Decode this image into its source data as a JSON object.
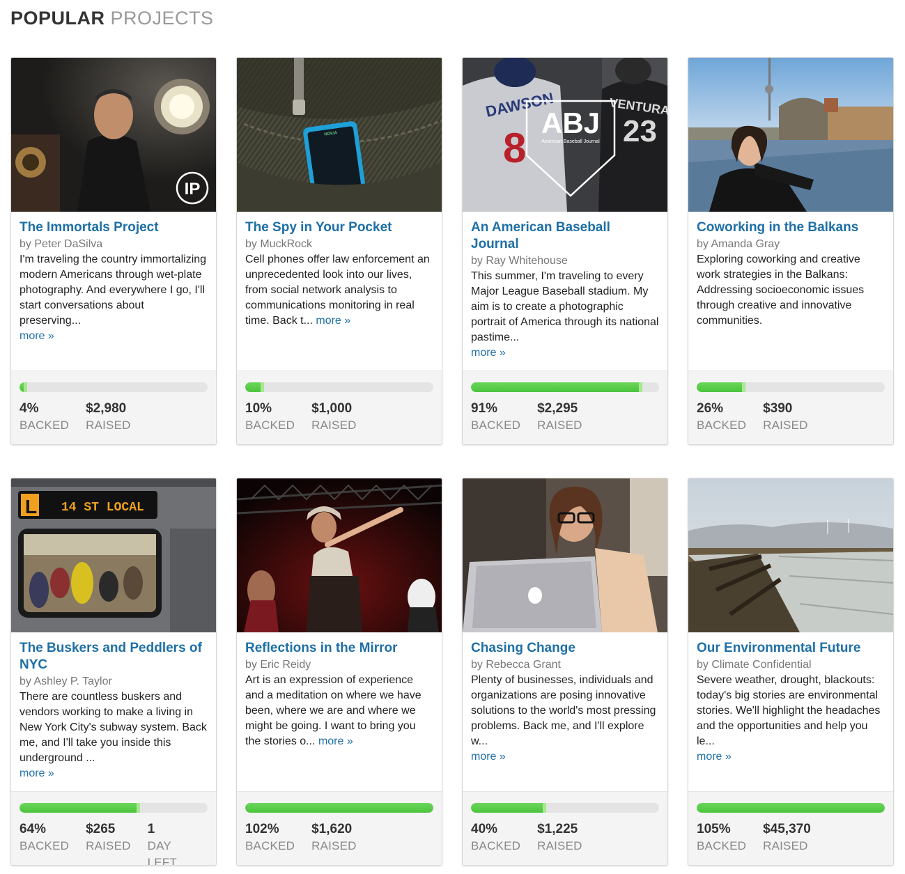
{
  "header": {
    "title_bold": "POPULAR",
    "title_light": "PROJECTS"
  },
  "colors": {
    "link": "#1e6fa6",
    "progress": "#4cc43e",
    "footer_bg": "#f4f4f4"
  },
  "projects": [
    {
      "title": "The Immortals Project",
      "author": "by Peter DaSilva",
      "description": "I'm traveling the country immortalizing modern Americans through wet-plate photography. And everywhere I go, I'll start conversations about preserving...",
      "more": "more »",
      "progress": 0.04,
      "stats": [
        {
          "value": "4%",
          "label": "BACKED"
        },
        {
          "value": "$2,980",
          "label": "RAISED"
        }
      ],
      "image_icon": "portrait-photo",
      "badge": "IP"
    },
    {
      "title": "The Spy in Your Pocket",
      "author": "by MuckRock",
      "description": "Cell phones offer law enforcement an unprecedented look into our lives, from social network analysis to communications monitoring in real time. Back t...",
      "more": "more »",
      "progress": 0.1,
      "stats": [
        {
          "value": "10%",
          "label": "BACKED"
        },
        {
          "value": "$1,000",
          "label": "RAISED"
        }
      ],
      "image_icon": "phone-in-pocket-photo",
      "phone_brand": "NOKIA"
    },
    {
      "title": "An American Baseball Journal",
      "author": "by Ray Whitehouse",
      "description": "This summer, I'm traveling to every Major League Baseball stadium. My aim is to create a photographic portrait of America through its national pastime...",
      "more": "more »",
      "progress": 0.91,
      "stats": [
        {
          "value": "91%",
          "label": "BACKED"
        },
        {
          "value": "$2,295",
          "label": "RAISED"
        }
      ],
      "image_icon": "baseball-fans-photo",
      "logo_big": "ABJ",
      "logo_small": "American Baseball Journal",
      "jersey_left": "DAWSON",
      "jersey_left_num": "8",
      "jersey_right": "VENTURA",
      "jersey_right_num": "23"
    },
    {
      "title": "Coworking in the Balkans",
      "author": "by Amanda Gray",
      "description": "Exploring coworking and creative work strategies in the Balkans: Addressing socioeconomic issues through creative and innovative communities.",
      "more": "",
      "progress": 0.26,
      "stats": [
        {
          "value": "26%",
          "label": "BACKED"
        },
        {
          "value": "$390",
          "label": "RAISED"
        }
      ],
      "image_icon": "woman-riverside-photo"
    },
    {
      "title": "The Buskers and Peddlers of NYC",
      "author": "by Ashley P. Taylor",
      "description": "There are countless buskers and vendors working to make a living in New York City's subway system. Back me, and I'll take you inside this underground ...",
      "more": "more »",
      "progress": 0.64,
      "stats": [
        {
          "value": "64%",
          "label": "BACKED"
        },
        {
          "value": "$265",
          "label": "RAISED"
        },
        {
          "value": "1",
          "label": "DAY LEFT"
        }
      ],
      "image_icon": "subway-train-photo",
      "train_line": "L",
      "train_sign": "14 ST LOCAL"
    },
    {
      "title": "Reflections in the Mirror",
      "author": "by Eric Reidy",
      "description": "Art is an expression of experience and a meditation on where we have been, where we are and where we might be going. I want to bring you the stories o...",
      "more": "more »",
      "progress": 1.02,
      "stats": [
        {
          "value": "102%",
          "label": "BACKED"
        },
        {
          "value": "$1,620",
          "label": "RAISED"
        }
      ],
      "image_icon": "stage-dancer-photo"
    },
    {
      "title": "Chasing Change",
      "author": "by Rebecca Grant",
      "description": "Plenty of businesses, individuals and organizations are posing innovative solutions to the world's most pressing problems. Back me, and I'll explore w...",
      "more": "more »",
      "progress": 0.4,
      "stats": [
        {
          "value": "40%",
          "label": "BACKED"
        },
        {
          "value": "$1,225",
          "label": "RAISED"
        }
      ],
      "image_icon": "woman-laptop-photo"
    },
    {
      "title": "Our Environmental Future",
      "author": "by Climate Confidential",
      "description": "Severe weather, drought, blackouts: today's big stories are environmental stories. We'll highlight the headaches and the opportunities and help you le...",
      "more": "more »",
      "progress": 1.05,
      "stats": [
        {
          "value": "105%",
          "label": "BACKED"
        },
        {
          "value": "$45,370",
          "label": "RAISED"
        }
      ],
      "image_icon": "landscape-fields-photo"
    }
  ]
}
